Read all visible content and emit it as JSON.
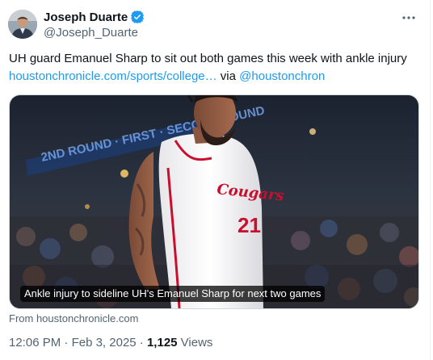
{
  "author": {
    "name": "Joseph Duarte",
    "handle": "@Joseph_Duarte",
    "verified_color": "#1d9bf0"
  },
  "tweet": {
    "text_before": "UH guard Emanuel Sharp to sit out both games this week with ankle injury ",
    "link_text": "houstonchronicle.com/sports/college…",
    "text_middle": " via ",
    "mention": "@houstonchron"
  },
  "card": {
    "caption": "Ankle injury to sideline UH's Emanuel Sharp for next two games",
    "source": "From houstonchronicle.com",
    "image": {
      "jersey_text": "Cougars",
      "jersey_number": "21",
      "banner_text": "2ND ROUND · FIRST · SECOND ROUND"
    }
  },
  "meta": {
    "time": "12:06 PM",
    "separator": " · ",
    "date": "Feb 3, 2025",
    "views_count": "1,125",
    "views_label": " Views"
  },
  "icons": {
    "verified": "verified-badge-icon",
    "more": "more-horizontal-icon"
  },
  "colors": {
    "text": "#0f1419",
    "secondary": "#536471",
    "link": "#1d9bf0",
    "jersey_red": "#c8102e"
  }
}
